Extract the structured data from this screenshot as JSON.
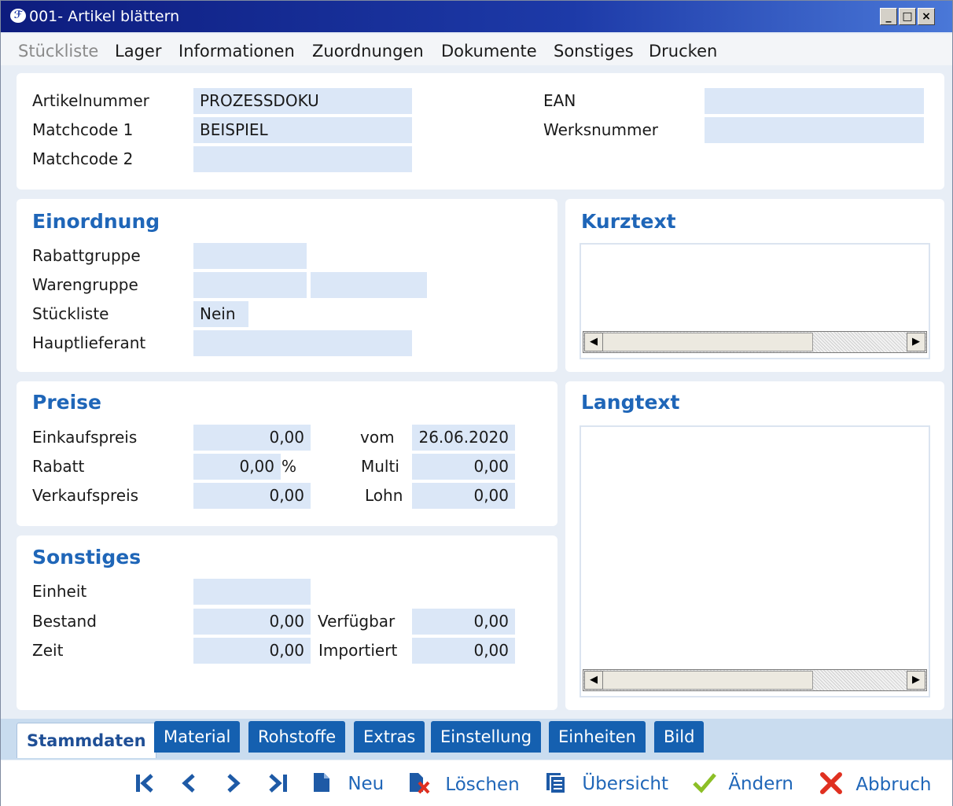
{
  "window": {
    "title": "001- Artikel blättern",
    "icon": "app-logo-icon",
    "controls": {
      "minimize": "_",
      "maximize": "□",
      "close": "×"
    }
  },
  "menu": {
    "items": [
      {
        "label": "Stückliste",
        "disabled": true
      },
      {
        "label": "Lager"
      },
      {
        "label": "Informationen"
      },
      {
        "label": "Zuordnungen"
      },
      {
        "label": "Dokumente"
      },
      {
        "label": "Sonstiges"
      },
      {
        "label": "Drucken"
      }
    ]
  },
  "header": {
    "artikelnummer_label": "Artikelnummer",
    "artikelnummer_value": "PROZESSDOKU",
    "matchcode1_label": "Matchcode 1",
    "matchcode1_value": "BEISPIEL",
    "matchcode2_label": "Matchcode 2",
    "matchcode2_value": "",
    "ean_label": "EAN",
    "ean_value": "",
    "werksnummer_label": "Werksnummer",
    "werksnummer_value": ""
  },
  "einordnung": {
    "title": "Einordnung",
    "rabattgruppe_label": "Rabattgruppe",
    "rabattgruppe_value": "",
    "warengruppe_label": "Warengruppe",
    "warengruppe_value1": "",
    "warengruppe_value2": "",
    "stueckliste_label": "Stückliste",
    "stueckliste_value": "Nein",
    "hauptlieferant_label": "Hauptlieferant",
    "hauptlieferant_value": ""
  },
  "kurztext": {
    "title": "Kurztext",
    "content": ""
  },
  "langtext": {
    "title": "Langtext",
    "content": ""
  },
  "preise": {
    "title": "Preise",
    "einkaufspreis_label": "Einkaufspreis",
    "einkaufspreis_value": "0,00",
    "rabatt_label": "Rabatt",
    "rabatt_value": "0,00",
    "rabatt_unit": "%",
    "verkaufspreis_label": "Verkaufspreis",
    "verkaufspreis_value": "0,00",
    "vom_label": "vom",
    "vom_value": "26.06.2020",
    "multi_label": "Multi",
    "multi_value": "0,00",
    "lohn_label": "Lohn",
    "lohn_value": "0,00"
  },
  "sonstiges": {
    "title": "Sonstiges",
    "einheit_label": "Einheit",
    "einheit_value": "",
    "bestand_label": "Bestand",
    "bestand_value": "0,00",
    "zeit_label": "Zeit",
    "zeit_value": "0,00",
    "verfuegbar_label": "Verfügbar",
    "verfuegbar_value": "0,00",
    "importiert_label": "Importiert",
    "importiert_value": "0,00"
  },
  "tabs": [
    {
      "label": "Stammdaten",
      "active": true
    },
    {
      "label": "Material"
    },
    {
      "label": "Rohstoffe"
    },
    {
      "label": "Extras"
    },
    {
      "label": "Einstellung"
    },
    {
      "label": "Einheiten"
    },
    {
      "label": "Bild"
    }
  ],
  "toolbar": {
    "first": "first-record-icon",
    "prev": "previous-record-icon",
    "next": "next-record-icon",
    "last": "last-record-icon",
    "neu_label": "Neu",
    "loeschen_label": "Löschen",
    "uebersicht_label": "Übersicht",
    "aendern_label": "Ändern",
    "abbruch_label": "Abbruch"
  },
  "colors": {
    "accent": "#1f66b8",
    "field_bg": "#dbe7f7",
    "tab_bg": "#1560b0",
    "check_green": "#8cbf26",
    "cancel_red": "#e03020"
  }
}
